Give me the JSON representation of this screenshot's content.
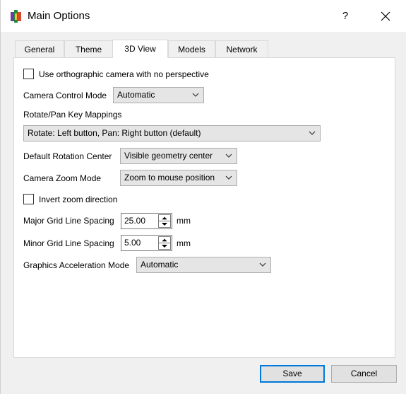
{
  "window": {
    "title": "Main Options",
    "help_label": "?"
  },
  "tabs": [
    {
      "label": "General",
      "active": false
    },
    {
      "label": "Theme",
      "active": false
    },
    {
      "label": "3D View",
      "active": true
    },
    {
      "label": "Models",
      "active": false
    },
    {
      "label": "Network",
      "active": false
    }
  ],
  "settings": {
    "ortho_camera": {
      "label": "Use orthographic camera with no perspective",
      "checked": false
    },
    "camera_control_mode": {
      "label": "Camera Control Mode",
      "value": "Automatic"
    },
    "key_mappings": {
      "label": "Rotate/Pan Key Mappings",
      "value": "Rotate: Left button, Pan: Right button (default)"
    },
    "rotation_center": {
      "label": "Default Rotation Center",
      "value": "Visible geometry center"
    },
    "zoom_mode": {
      "label": "Camera Zoom Mode",
      "value": "Zoom to mouse position"
    },
    "invert_zoom": {
      "label": "Invert zoom direction",
      "checked": false
    },
    "major_grid": {
      "label": "Major Grid Line Spacing",
      "value": "25.00",
      "unit": "mm"
    },
    "minor_grid": {
      "label": "Minor Grid Line Spacing",
      "value": "5.00",
      "unit": "mm"
    },
    "graphics_accel": {
      "label": "Graphics Acceleration Mode",
      "value": "Automatic"
    }
  },
  "buttons": {
    "save": "Save",
    "cancel": "Cancel"
  },
  "icons": {
    "app": "app-logo-icon",
    "close": "close-icon",
    "dropdown": "chevron-down-icon",
    "spin_up": "spin-up-icon",
    "spin_down": "spin-down-icon"
  },
  "colors": {
    "accent": "#0078d7",
    "titlebar": "#ffffff",
    "dialog_bg": "#f0f0f0"
  }
}
